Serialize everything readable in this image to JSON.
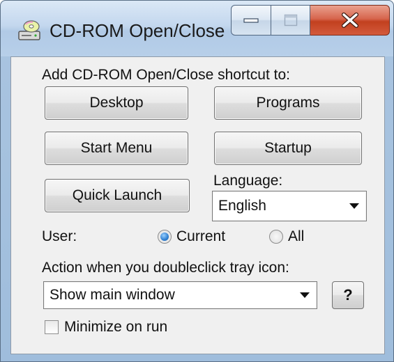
{
  "window": {
    "title": "CD-ROM Open/Close",
    "icon": "cd-drive-icon"
  },
  "caption": {
    "minimize_icon": "minimize-icon",
    "maximize_icon": "maximize-icon",
    "close_icon": "close-icon"
  },
  "shortcut": {
    "label": "Add CD-ROM Open/Close shortcut to:",
    "desktop": "Desktop",
    "programs": "Programs",
    "start_menu": "Start Menu",
    "startup": "Startup",
    "quick_launch": "Quick Launch"
  },
  "language": {
    "label": "Language:",
    "value": "English"
  },
  "user": {
    "label": "User:",
    "current": "Current",
    "all": "All",
    "selected": "Current"
  },
  "action": {
    "label": "Action when you doubleclick tray icon:",
    "value": "Show main window",
    "help": "?"
  },
  "minimize_on_run": {
    "label": "Minimize on run",
    "checked": false
  },
  "colors": {
    "titlebar": "#c3d7ee",
    "close_button": "#c2401f",
    "face": "#f0f0f0",
    "radio_accent": "#2f7fd0"
  }
}
